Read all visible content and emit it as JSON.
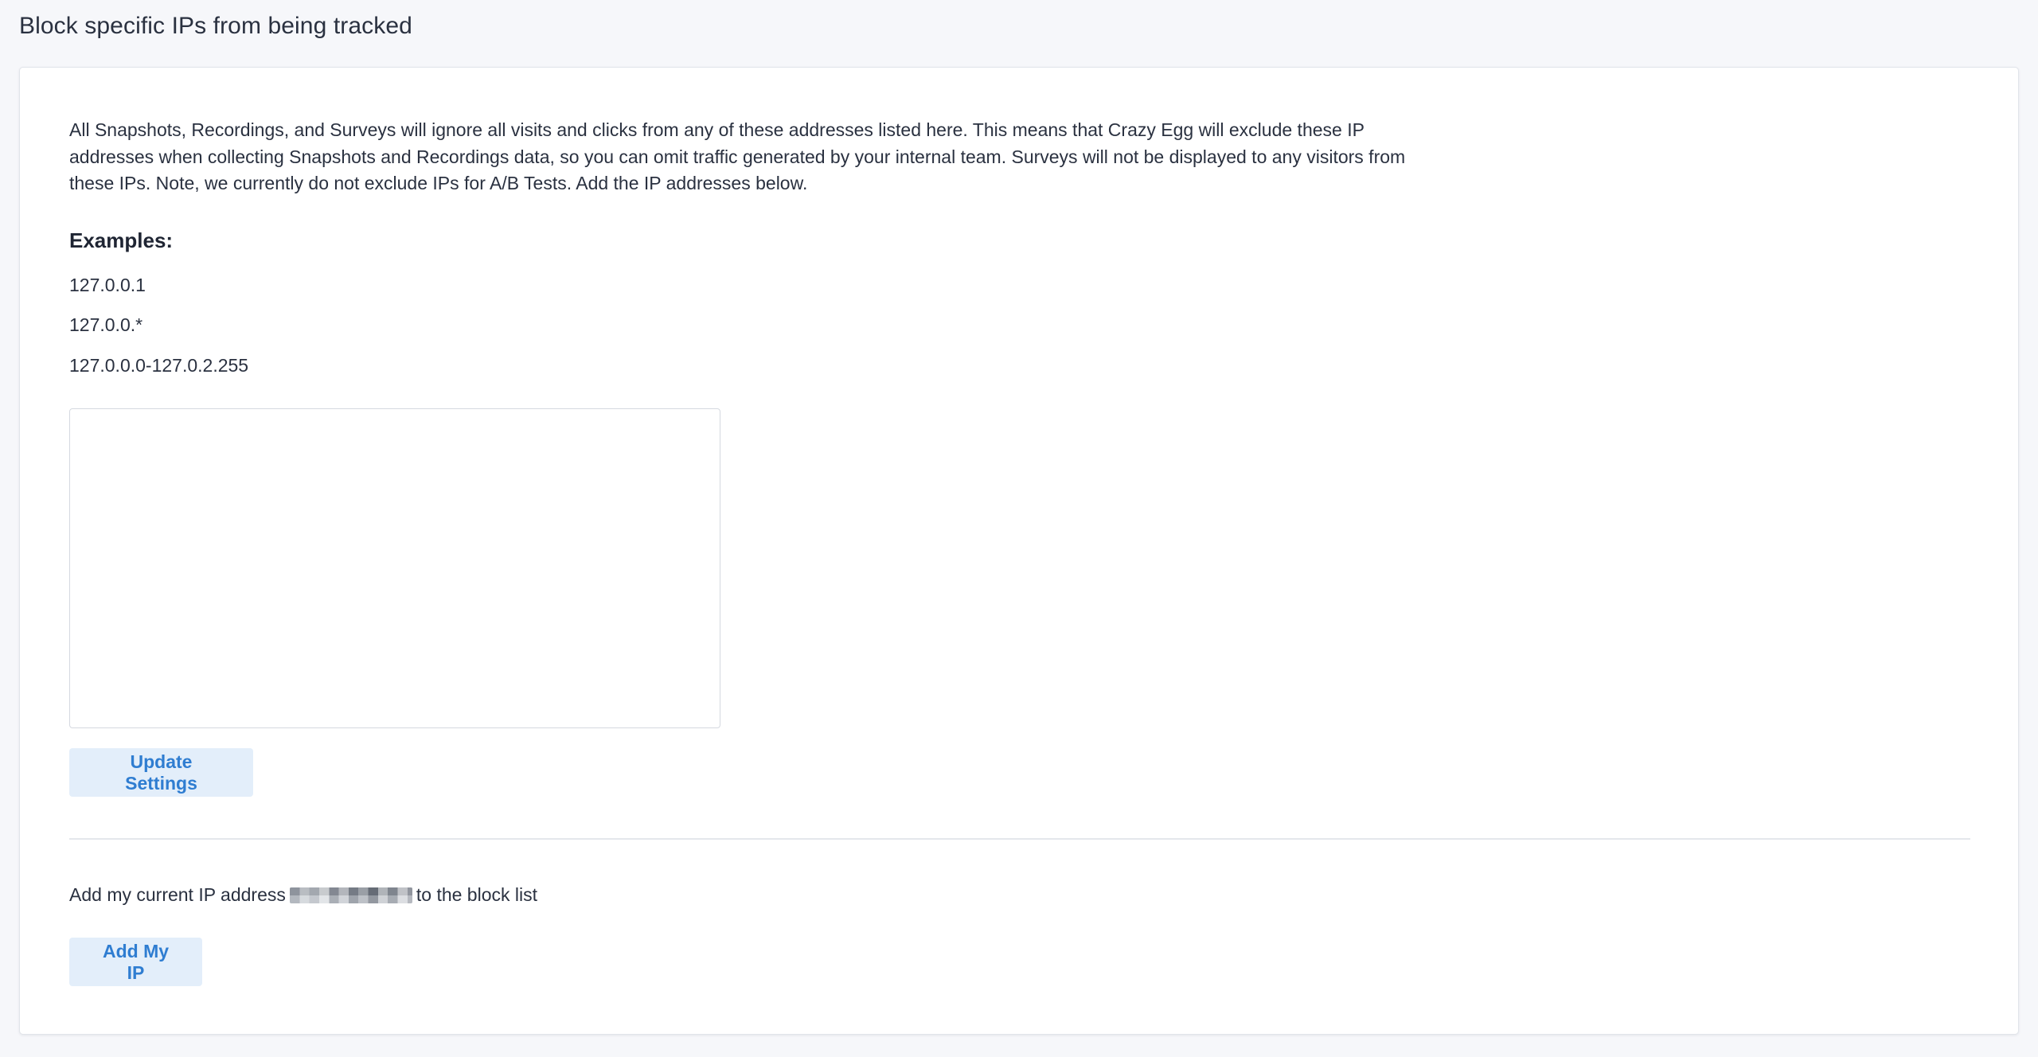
{
  "page": {
    "title": "Block specific IPs from being tracked"
  },
  "card": {
    "description": "All Snapshots, Recordings, and Surveys will ignore all visits and clicks from any of these addresses listed here. This means that Crazy Egg will exclude these IP addresses when collecting Snapshots and Recordings data, so you can omit traffic generated by your internal team. Surveys will not be displayed to any visitors from these IPs. Note, we currently do not exclude IPs for A/B Tests. Add the IP addresses below.",
    "examples_heading": "Examples:",
    "examples": [
      "127.0.0.1",
      "127.0.0.*",
      "127.0.0.0-127.0.2.255"
    ],
    "ip_list_value": "",
    "update_button_label": "Update Settings",
    "current_ip_prefix": "Add my current IP address",
    "current_ip_suffix": "to the block list",
    "add_ip_button_label": "Add My IP"
  },
  "colors": {
    "background": "#f6f7fa",
    "card": "#ffffff",
    "button_bg": "#e3eefa",
    "button_text": "#2f7dd1",
    "text": "#2a3140"
  }
}
